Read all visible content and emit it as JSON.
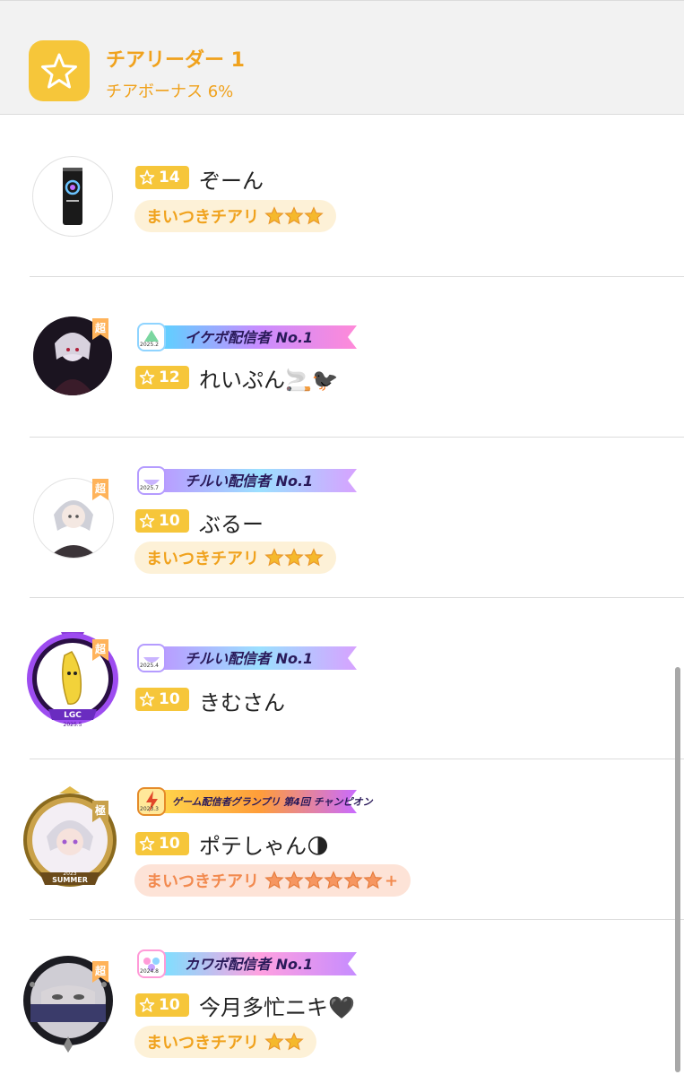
{
  "header": {
    "title": "チアリーダー 1",
    "subtitle": "チアボーナス 6%",
    "icon": "star-icon",
    "accent": "#f6c63a"
  },
  "super_label": "超",
  "cheerers": [
    {
      "rank": "14",
      "name": "ぞーん",
      "pill_label": "まいつきチアリ",
      "pill_stars": 3,
      "badge": null,
      "avatar": "energy-drink-can"
    },
    {
      "rank": "12",
      "name": "れいぷん🚬🐦‍⬛",
      "badge": {
        "text": "イケボ配信者 No.1",
        "year": "2025.2"
      },
      "avatar": "dark-anime-character"
    },
    {
      "rank": "10",
      "name": "ぶるー",
      "pill_label": "まいつきチアリ",
      "pill_stars": 3,
      "badge": {
        "text": "チルい配信者 No.1",
        "year": "2025.7"
      },
      "avatar": "silver-hair-character"
    },
    {
      "rank": "10",
      "name": "きむさん",
      "badge": {
        "text": "チルい配信者 No.1",
        "year": "2025.4"
      },
      "avatar": "banana-character",
      "avatar_frame_text": "LGC",
      "avatar_frame_year": "2025.5"
    },
    {
      "rank": "10",
      "name": "ポテしゃん🌗",
      "pill_label": "まいつきチアリ",
      "pill_stars": 6,
      "pill_plus": "+",
      "badge": {
        "text": "ゲーム配信者グランプリ 第4回 チャンピオン",
        "year": "2023.3"
      },
      "avatar": "gold-frame-character",
      "avatar_frame_text": "SUMMER",
      "avatar_frame_year": "2023"
    },
    {
      "rank": "10",
      "name": "今月多忙ニキ🖤",
      "pill_label": "まいつきチアリ",
      "pill_stars": 2,
      "badge": {
        "text": "カワボ配信者 No.1",
        "year": "2024.8"
      },
      "avatar": "masked-face-character"
    }
  ]
}
